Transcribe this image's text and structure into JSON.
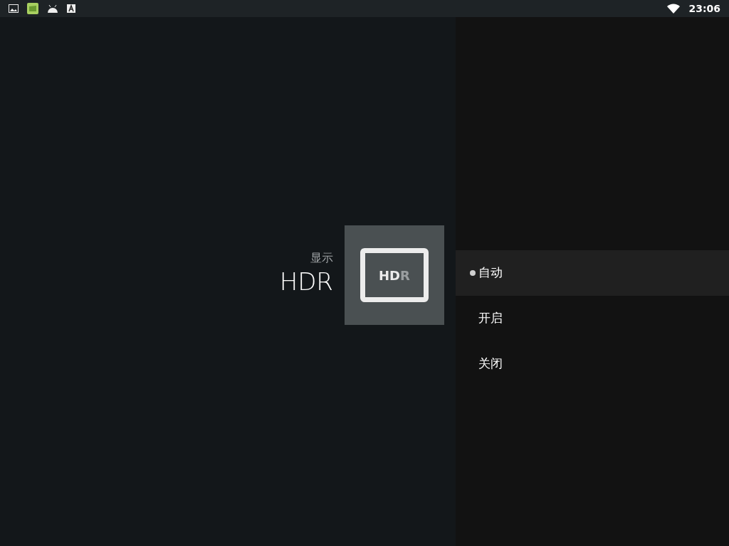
{
  "status_bar": {
    "time": "23:06"
  },
  "header": {
    "category": "显示",
    "title": "HDR",
    "badge_text": "HDR"
  },
  "options": [
    {
      "label": "自动",
      "selected": true
    },
    {
      "label": "开启",
      "selected": false
    },
    {
      "label": "关闭",
      "selected": false
    }
  ]
}
